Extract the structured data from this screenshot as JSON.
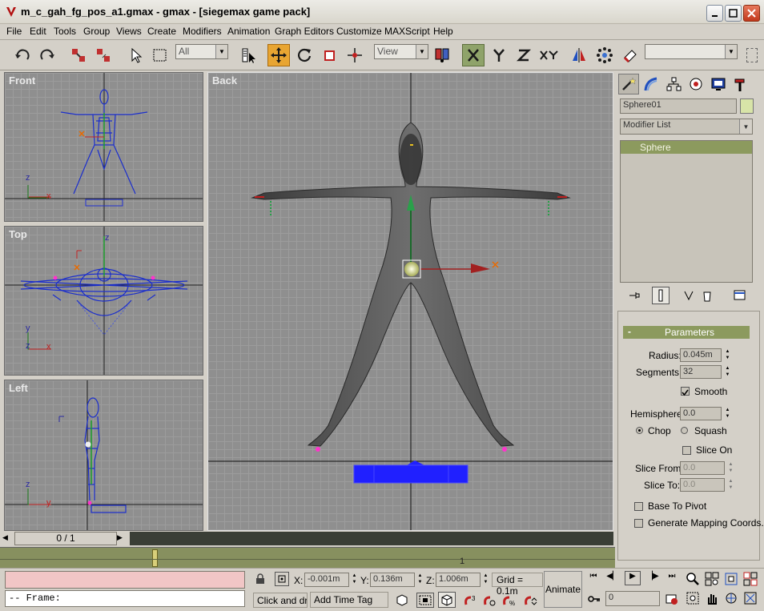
{
  "window": {
    "title": "m_c_gah_fg_pos_a1.gmax - gmax - [siegemax game pack]"
  },
  "menu": [
    "File",
    "Edit",
    "Tools",
    "Group",
    "Views",
    "Create",
    "Modifiers",
    "Animation",
    "Graph Editors",
    "Customize",
    "MAXScript",
    "Help"
  ],
  "toolbar": {
    "selection_filter": "All",
    "reference_coord": "View",
    "named_selection": ""
  },
  "viewports": {
    "front": "Front",
    "top": "Top",
    "left": "Left",
    "back": "Back"
  },
  "axis": {
    "x": "x",
    "y": "y",
    "z": "z"
  },
  "time_slider": {
    "label": "0 / 1",
    "frame_tick": "1"
  },
  "command_panel": {
    "object_name": "Sphere01",
    "object_color": "#d8e4a8",
    "modifier_list": "Modifier List",
    "stack_items": [
      "Sphere"
    ],
    "rollout_title": "Parameters",
    "rollout_sign": "-",
    "radius_label": "Radius:",
    "radius_value": "0.045m",
    "segments_label": "Segments:",
    "segments_value": "32",
    "smooth_label": "Smooth",
    "smooth_checked": true,
    "hemisphere_label": "Hemisphere:",
    "hemisphere_value": "0.0",
    "chop_label": "Chop",
    "squash_label": "Squash",
    "hemi_mode": "Chop",
    "slice_on_label": "Slice On",
    "slice_from_label": "Slice From:",
    "slice_from_value": "0.0",
    "slice_to_label": "Slice To:",
    "slice_to_value": "0.0",
    "base_to_pivot_label": "Base To Pivot",
    "mapping_label": "Generate Mapping Coords."
  },
  "status": {
    "maxscript_line": "--  Frame:",
    "x_label": "X:",
    "x_value": "-0.001m",
    "y_label": "Y:",
    "y_value": "0.136m",
    "z_label": "Z:",
    "z_value": "1.006m",
    "grid": "Grid = 0.1m",
    "prompt": "Click and dra",
    "add_time_tag": "Add Time Tag",
    "animate": "Animate",
    "frame_value": "0"
  },
  "colors": {
    "accent": "#e8a532",
    "track": "#87905f",
    "platform": "#2020ff",
    "listener": "#f1c6c6"
  }
}
